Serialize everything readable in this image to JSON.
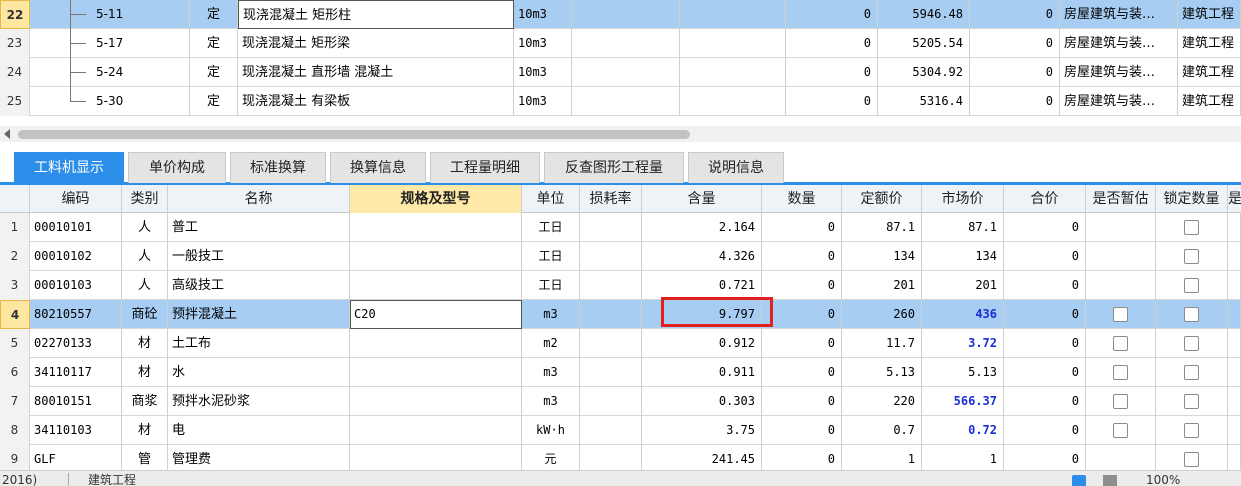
{
  "top_table": {
    "rows": [
      {
        "num": "22",
        "code": "5-11",
        "type": "定",
        "name": "现浇混凝土 矩形柱",
        "unit": "10m3",
        "v1": "0",
        "price": "5946.48",
        "v2": "0",
        "category": "房屋建筑与装…",
        "profession": "建筑工程",
        "selected": true
      },
      {
        "num": "23",
        "code": "5-17",
        "type": "定",
        "name": "现浇混凝土 矩形梁",
        "unit": "10m3",
        "v1": "0",
        "price": "5205.54",
        "v2": "0",
        "category": "房屋建筑与装…",
        "profession": "建筑工程",
        "selected": false
      },
      {
        "num": "24",
        "code": "5-24",
        "type": "定",
        "name": "现浇混凝土 直形墙 混凝土",
        "unit": "10m3",
        "v1": "0",
        "price": "5304.92",
        "v2": "0",
        "category": "房屋建筑与装…",
        "profession": "建筑工程",
        "selected": false
      },
      {
        "num": "25",
        "code": "5-30",
        "type": "定",
        "name": "现浇混凝土 有梁板",
        "unit": "10m3",
        "v1": "0",
        "price": "5316.4",
        "v2": "0",
        "category": "房屋建筑与装…",
        "profession": "建筑工程",
        "selected": false
      }
    ]
  },
  "tabs": [
    {
      "label": "工料机显示",
      "active": true
    },
    {
      "label": "单价构成",
      "active": false
    },
    {
      "label": "标准换算",
      "active": false
    },
    {
      "label": "换算信息",
      "active": false
    },
    {
      "label": "工程量明细",
      "active": false
    },
    {
      "label": "反查图形工程量",
      "active": false
    },
    {
      "label": "说明信息",
      "active": false
    }
  ],
  "grid": {
    "headers": {
      "code": "编码",
      "category": "类别",
      "name": "名称",
      "spec": "规格及型号",
      "unit": "单位",
      "loss": "损耗率",
      "content": "含量",
      "qty": "数量",
      "quota_price": "定额价",
      "market_price": "市场价",
      "total": "合价",
      "provisional": "是否暂估",
      "lock_qty": "锁定数量",
      "more": "是"
    },
    "rows": [
      {
        "rn": "1",
        "code": "00010101",
        "cat": "人",
        "name": "普工",
        "spec": "",
        "unit": "工日",
        "content": "2.164",
        "qty": "0",
        "quota": "87.1",
        "market": "87.1",
        "market_blue": false,
        "total": "0",
        "prov_check": false,
        "selected": false
      },
      {
        "rn": "2",
        "code": "00010102",
        "cat": "人",
        "name": "一般技工",
        "spec": "",
        "unit": "工日",
        "content": "4.326",
        "qty": "0",
        "quota": "134",
        "market": "134",
        "market_blue": false,
        "total": "0",
        "prov_check": false,
        "selected": false
      },
      {
        "rn": "3",
        "code": "00010103",
        "cat": "人",
        "name": "高级技工",
        "spec": "",
        "unit": "工日",
        "content": "0.721",
        "qty": "0",
        "quota": "201",
        "market": "201",
        "market_blue": false,
        "total": "0",
        "prov_check": false,
        "selected": false
      },
      {
        "rn": "4",
        "code": "80210557",
        "cat": "商砼",
        "name": "预拌混凝土",
        "spec": "C20",
        "unit": "m3",
        "content": "9.797",
        "qty": "0",
        "quota": "260",
        "market": "436",
        "market_blue": true,
        "total": "0",
        "prov_check": true,
        "selected": true
      },
      {
        "rn": "5",
        "code": "02270133",
        "cat": "材",
        "name": "土工布",
        "spec": "",
        "unit": "m2",
        "content": "0.912",
        "qty": "0",
        "quota": "11.7",
        "market": "3.72",
        "market_blue": true,
        "total": "0",
        "prov_check": true,
        "selected": false
      },
      {
        "rn": "6",
        "code": "34110117",
        "cat": "材",
        "name": "水",
        "spec": "",
        "unit": "m3",
        "content": "0.911",
        "qty": "0",
        "quota": "5.13",
        "market": "5.13",
        "market_blue": false,
        "total": "0",
        "prov_check": true,
        "selected": false
      },
      {
        "rn": "7",
        "code": "80010151",
        "cat": "商浆",
        "name": "预拌水泥砂浆",
        "spec": "",
        "unit": "m3",
        "content": "0.303",
        "qty": "0",
        "quota": "220",
        "market": "566.37",
        "market_blue": true,
        "total": "0",
        "prov_check": true,
        "selected": false
      },
      {
        "rn": "8",
        "code": "34110103",
        "cat": "材",
        "name": "电",
        "spec": "",
        "unit": "kW·h",
        "content": "3.75",
        "qty": "0",
        "quota": "0.7",
        "market": "0.72",
        "market_blue": true,
        "total": "0",
        "prov_check": true,
        "selected": false
      },
      {
        "rn": "9",
        "code": "GLF",
        "cat": "管",
        "name": "管理费",
        "spec": "",
        "unit": "元",
        "content": "241.45",
        "qty": "0",
        "quota": "1",
        "market": "1",
        "market_blue": false,
        "total": "0",
        "prov_check": false,
        "selected": false
      }
    ]
  },
  "status_bar": {
    "left_text": "2016)",
    "middle_text": "建筑工程",
    "zoom": "100%"
  },
  "colors": {
    "selection": "#a7cdf3",
    "active_tab": "#2d8ee9",
    "blue_price": "#1a2fd6",
    "highlight_box": "#e22020"
  }
}
